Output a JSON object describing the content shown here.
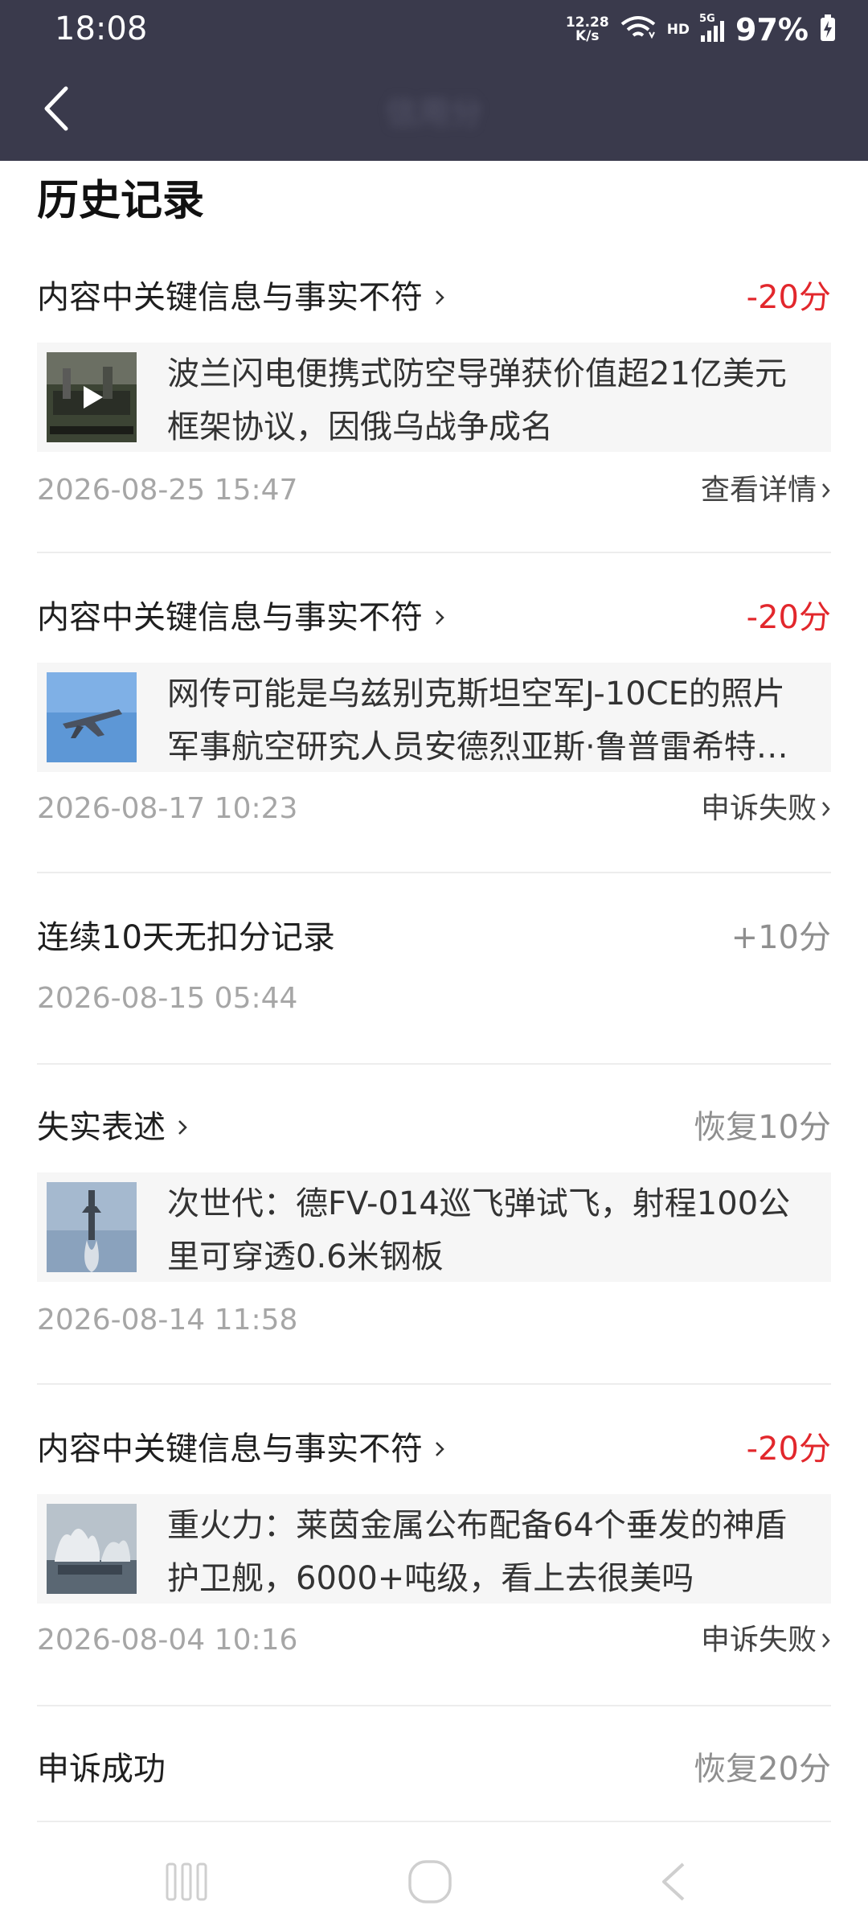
{
  "status_bar": {
    "time": "18:08",
    "speed_value": "12.28",
    "speed_unit": "K/s",
    "hd": "HD",
    "network": "5G",
    "battery": "97%"
  },
  "header": {
    "title": "信用分"
  },
  "section_title": "历史记录",
  "records": [
    {
      "type": "内容中关键信息与事实不符",
      "score": "-20分",
      "article": "波兰闪电便携式防空导弹获价值超21亿美元框架协议，因俄乌战争成名",
      "date": "2026-08-25 15:47",
      "action": "查看详情"
    },
    {
      "type": "内容中关键信息与事实不符",
      "score": "-20分",
      "article": "网传可能是乌兹别克斯坦空军J-10CE的照片 军事航空研究人员安德烈亚斯·鲁普雷希特发布",
      "date": "2026-08-17 10:23",
      "action": "申诉失败"
    },
    {
      "type": "连续10天无扣分记录",
      "score": "+10分",
      "date": "2026-08-15 05:44"
    },
    {
      "type": "失实表述",
      "score": "恢复10分",
      "article": "次世代：德FV-014巡飞弹试飞，射程100公里可穿透0.6米钢板",
      "date": "2026-08-14 11:58"
    },
    {
      "type": "内容中关键信息与事实不符",
      "score": "-20分",
      "article": "重火力：莱茵金属公布配备64个垂发的神盾护卫舰，6000+吨级，看上去很美吗",
      "date": "2026-08-04 10:16",
      "action": "申诉失败"
    },
    {
      "type": "申诉成功",
      "score": "恢复20分"
    }
  ],
  "colors": {
    "header_bg": "#3a3a4c",
    "deduction": "#e2272c",
    "neutral_score": "#8f8f8f"
  }
}
